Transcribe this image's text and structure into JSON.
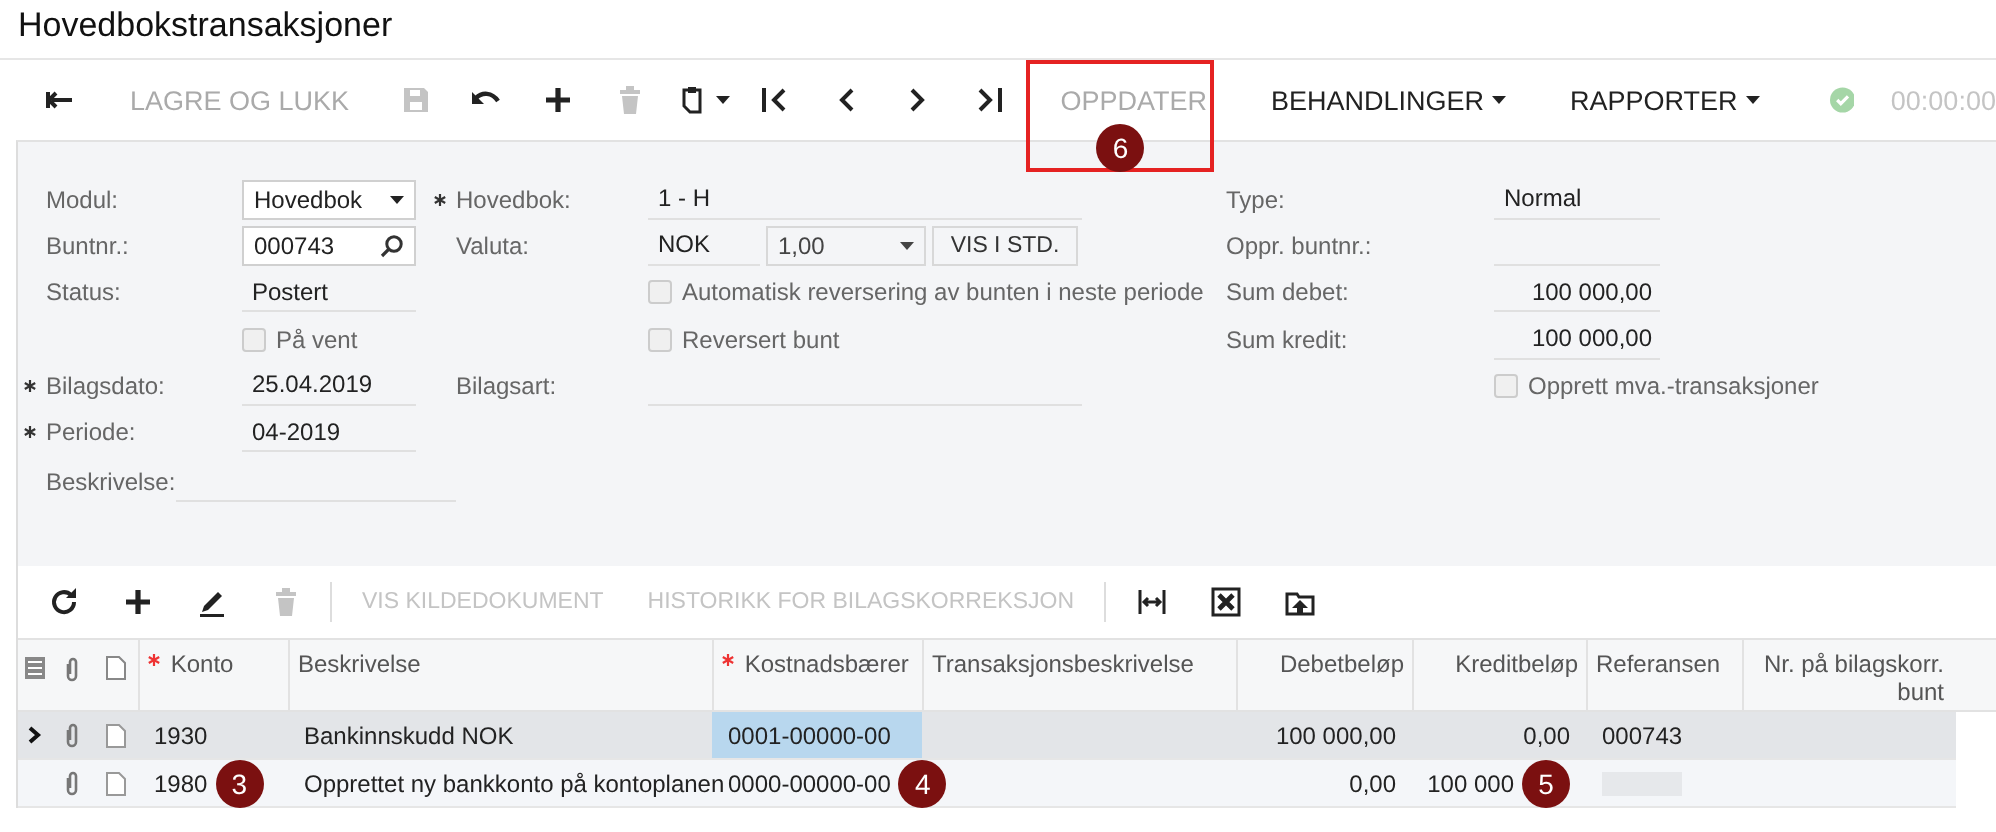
{
  "title": "Hovedbokstransaksjoner",
  "toolbar": [
    {
      "kind": "icon",
      "disabled": false
    },
    {
      "kind": "text",
      "label": "LAGRE OG LUKK",
      "disabled": true,
      "dropdown": false
    },
    {
      "kind": "icon",
      "disabled": true
    },
    {
      "kind": "icon",
      "disabled": false
    },
    {
      "kind": "icon",
      "disabled": false
    },
    {
      "kind": "icon",
      "disabled": true
    },
    {
      "kind": "icon",
      "disabled": false,
      "dropdown": true
    },
    {
      "kind": "icon",
      "disabled": false
    },
    {
      "kind": "icon",
      "disabled": false
    },
    {
      "kind": "icon",
      "disabled": false
    },
    {
      "kind": "icon",
      "disabled": false
    },
    {
      "kind": "text",
      "label": "OPPDATER",
      "disabled": true,
      "dropdown": false,
      "marker": "6"
    },
    {
      "kind": "text",
      "label": "BEHANDLINGER",
      "disabled": false,
      "dropdown": true
    },
    {
      "kind": "text",
      "label": "RAPPORTER",
      "disabled": false,
      "dropdown": true
    },
    {
      "kind": "status"
    },
    {
      "kind": "timer",
      "label": "00:00:00"
    }
  ],
  "form": {
    "column_1": [
      {
        "kind": "select",
        "label": "Modul:",
        "required": false,
        "value": "Hovedbok"
      },
      {
        "kind": "lookup",
        "label": "Buntnr.:",
        "required": false,
        "value": "000743"
      },
      {
        "kind": "text",
        "label": "Status:",
        "required": false,
        "value": "Postert"
      },
      {
        "kind": "checkbox",
        "label": "På vent",
        "checked": false
      },
      {
        "kind": "text",
        "label": "Bilagsdato:",
        "required": true,
        "value": "25.04.2019"
      },
      {
        "kind": "text",
        "label": "Periode:",
        "required": true,
        "value": "04-2019"
      },
      {
        "kind": "wide",
        "label": "Beskrivelse:",
        "required": false
      }
    ],
    "column_2": [
      {
        "kind": "text",
        "label": "Hovedbok:",
        "required": true,
        "value": "1 - H"
      },
      {
        "kind": "currency",
        "label": "Valuta:",
        "required": false,
        "value": "NOK",
        "rate": "1,00",
        "button": "VIS I STD."
      },
      {
        "kind": "checkbox",
        "label": "Automatisk reversering av bunten i neste periode",
        "checked": false
      },
      {
        "kind": "checkbox",
        "label": "Reversert bunt",
        "checked": false
      },
      {
        "kind": "text",
        "label": "Bilagsart:",
        "required": false
      }
    ],
    "column_3": [
      {
        "kind": "text",
        "label": "Type:",
        "required": false,
        "value": "Normal"
      },
      {
        "kind": "text",
        "label": "Oppr. buntnr.:",
        "required": false
      },
      {
        "kind": "number",
        "label": "Sum debet:",
        "required": false,
        "value": "100 000,00"
      },
      {
        "kind": "number",
        "label": "Sum kredit:",
        "required": false,
        "value": "100 000,00"
      },
      {
        "kind": "checkbox",
        "label": "Opprett mva.-transaksjoner",
        "checked": false
      }
    ]
  },
  "grid_toolbar": [
    {
      "kind": "icon",
      "disabled": false
    },
    {
      "kind": "icon",
      "disabled": false
    },
    {
      "kind": "icon",
      "disabled": false
    },
    {
      "kind": "icon",
      "disabled": true
    },
    {
      "kind": "separator"
    },
    {
      "kind": "text",
      "label": "VIS KILDEDOKUMENT",
      "disabled": true
    },
    {
      "kind": "text",
      "label": "HISTORIKK FOR BILAGSKORREKSJON",
      "disabled": true
    },
    {
      "kind": "separator"
    },
    {
      "kind": "icon",
      "disabled": false
    },
    {
      "kind": "icon",
      "disabled": false
    },
    {
      "kind": "icon",
      "disabled": false
    }
  ],
  "table": {
    "columns": [
      {
        "label": "Konto",
        "required": true
      },
      {
        "label": "Beskrivelse",
        "required": false
      },
      {
        "label": "Kostnadsbærer",
        "required": true
      },
      {
        "label": "Transaksjonsbeskrivelse",
        "required": false
      },
      {
        "label": "Debetbeløp",
        "required": false
      },
      {
        "label": "Kreditbeløp",
        "required": false
      },
      {
        "label": "Referansen",
        "required": false
      },
      {
        "label": "Nr. på bilagskorr. bunt",
        "required": false
      }
    ],
    "rows": [
      {
        "selected": true,
        "cells": [
          {
            "text": "1930"
          },
          {
            "text": "Bankinnskudd NOK"
          },
          {
            "text": "0001-00000-00",
            "active": true
          },
          {},
          {
            "text": "100 000,00"
          },
          {
            "text": "0,00"
          },
          {
            "text": "000743"
          },
          {}
        ]
      },
      {
        "selected": false,
        "cells": [
          {
            "text": "1980",
            "marker": "3"
          },
          {
            "text": "Opprettet ny bankkonto på kontoplanen"
          },
          {
            "text": "0000-00000-00",
            "active": false,
            "marker": "4"
          },
          {},
          {
            "text": "0,00"
          },
          {
            "text": "100 000",
            "marker": "5"
          },
          {
            "redacted": true
          },
          {}
        ]
      }
    ]
  }
}
